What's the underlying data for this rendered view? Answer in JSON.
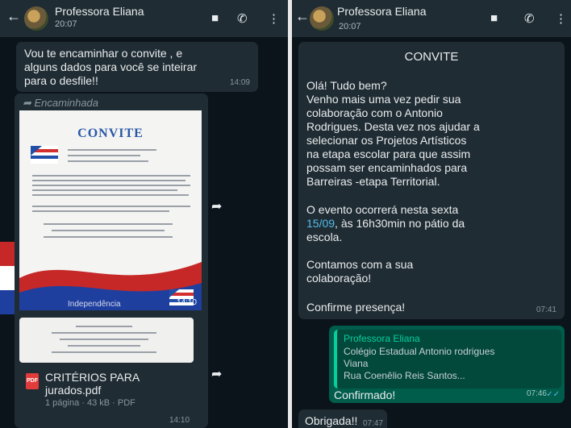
{
  "left": {
    "header": {
      "name": "Professora Eliana",
      "time": "20:07"
    },
    "msg1": {
      "text": "Vou te encaminhar o convite , e\nalguns dados para você se inteirar\npara o desfile!!",
      "time": "14:09"
    },
    "forwarded_label": "Encaminhada",
    "invite_image": {
      "title": "CONVITE",
      "footer_text": "Independência",
      "time": "14:10"
    },
    "pdf": {
      "filename": "CRITÉRIOS PARA\njurados.pdf",
      "meta": "1 página · 43 kB · PDF",
      "time": "14:10"
    }
  },
  "right": {
    "header": {
      "name": "Professora Eliana",
      "time": "20:07"
    },
    "msg": {
      "title": "CONVITE",
      "greeting": "Olá! Tudo bem?",
      "body1": "Venho mais uma vez pedir sua\ncolaboração com o Antonio\nRodrigues. Desta vez nos ajudar a\nselecionar os Projetos Artísticos\nna etapa escolar para que assim\npossam ser encaminhados para\nBarreiras -etapa Territorial.",
      "body2_prefix": "O evento ocorrerá nesta sexta",
      "body2_date": "15/09",
      "body2_rest": ", às 16h30min no pátio da\nescola.",
      "body3": "Contamos com a sua\ncolaboração!",
      "confirm": "Confirme presença!",
      "time": "07:41"
    },
    "reply": {
      "quoted_author": "Professora Eliana",
      "quoted_text": "Colégio Estadual Antonio rodrigues\nViana\nRua Coenêlio Reis Santos...",
      "text": "Confirmado!",
      "time": "07:46"
    },
    "last_msg": {
      "text": "Obrigada!!",
      "time": "07:47"
    }
  },
  "colors": {
    "incoming_bubble": "#202c33",
    "outgoing_bubble": "#005c4b",
    "accent_link": "#53bdeb",
    "quote_author": "#06cf9c"
  }
}
